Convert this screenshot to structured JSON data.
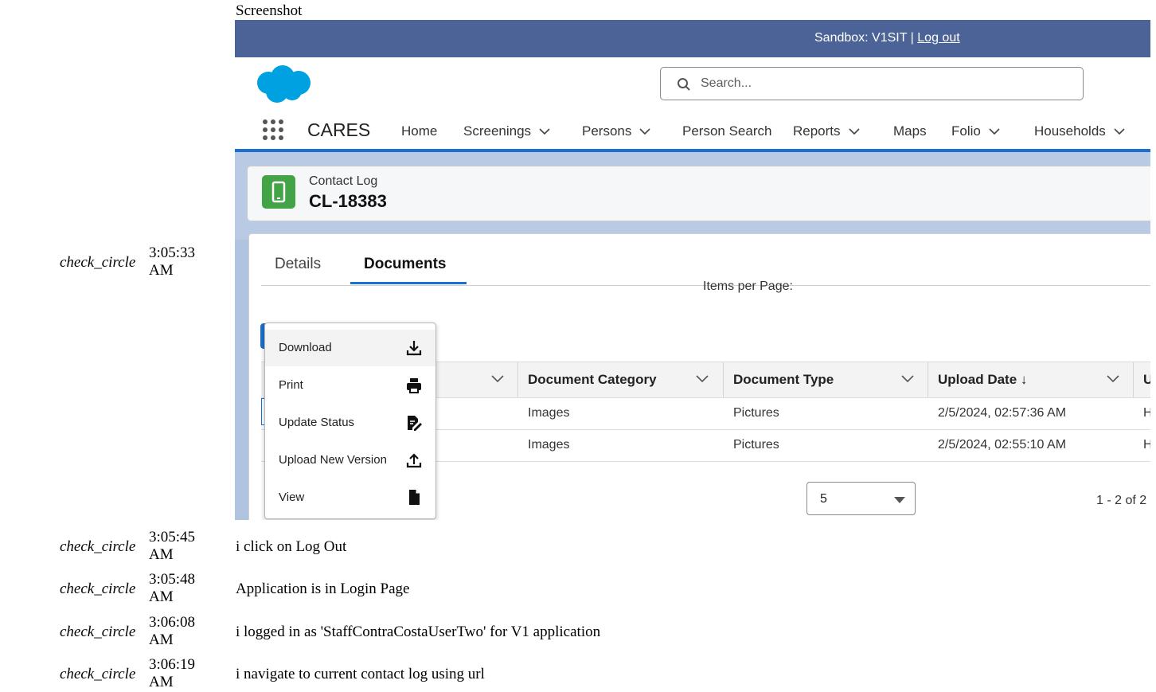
{
  "page": {
    "screenshot_label": "Screenshot"
  },
  "log": [
    {
      "icon": "check_circle",
      "time_line1": "3:05:33",
      "time_line2": "AM",
      "message": ""
    },
    {
      "icon": "check_circle",
      "time_line1": "3:05:45",
      "time_line2": "AM",
      "message": "i click on Log Out"
    },
    {
      "icon": "check_circle",
      "time_line1": "3:05:48",
      "time_line2": "AM",
      "message": "Application is in Login Page"
    },
    {
      "icon": "check_circle",
      "time_line1": "3:06:08",
      "time_line2": "AM",
      "message": "i logged in as 'StaffContraCostaUserTwo' for V1 application"
    },
    {
      "icon": "check_circle",
      "time_line1": "3:06:19",
      "time_line2": "AM",
      "message": "i navigate to current contact log using url"
    }
  ],
  "app": {
    "sandbox_text": "Sandbox: V1SIT | ",
    "logout_link": "Log out",
    "search_placeholder": "Search...",
    "app_name": "CARES",
    "nav": [
      {
        "label": "Home",
        "dropdown": false
      },
      {
        "label": "Screenings",
        "dropdown": true
      },
      {
        "label": "Persons",
        "dropdown": true
      },
      {
        "label": "Person Search",
        "dropdown": false
      },
      {
        "label": "Reports",
        "dropdown": true
      },
      {
        "label": "Maps",
        "dropdown": false
      },
      {
        "label": "Folio",
        "dropdown": true
      },
      {
        "label": "Households",
        "dropdown": true
      }
    ],
    "record_type": "Contact Log",
    "record_name": "CL-18383",
    "tabs": [
      {
        "label": "Details",
        "active": false
      },
      {
        "label": "Documents",
        "active": true
      }
    ],
    "columns": [
      "Document Category",
      "Document Type",
      "Upload Date ↓",
      "U"
    ],
    "rows": [
      {
        "category": "Images",
        "type": "Pictures",
        "upload_date": "2/5/2024, 02:57:36 AM",
        "trunc": "H"
      },
      {
        "category": "Images",
        "type": "Pictures",
        "upload_date": "2/5/2024, 02:55:10 AM",
        "trunc": "H"
      }
    ],
    "items_per_page_label": "Items per Page:",
    "items_per_page_value": "5",
    "range_text": "1 - 2 of 2",
    "menu": [
      {
        "label": "Download",
        "icon": "download-icon"
      },
      {
        "label": "Print",
        "icon": "print-icon"
      },
      {
        "label": "Update Status",
        "icon": "edit-document-icon"
      },
      {
        "label": "Upload New Version",
        "icon": "upload-icon"
      },
      {
        "label": "View",
        "icon": "file-icon"
      }
    ],
    "colors": {
      "header_bar": "#4b6396",
      "brand_blue": "#1b6fd1",
      "record_icon": "#43a447"
    }
  }
}
